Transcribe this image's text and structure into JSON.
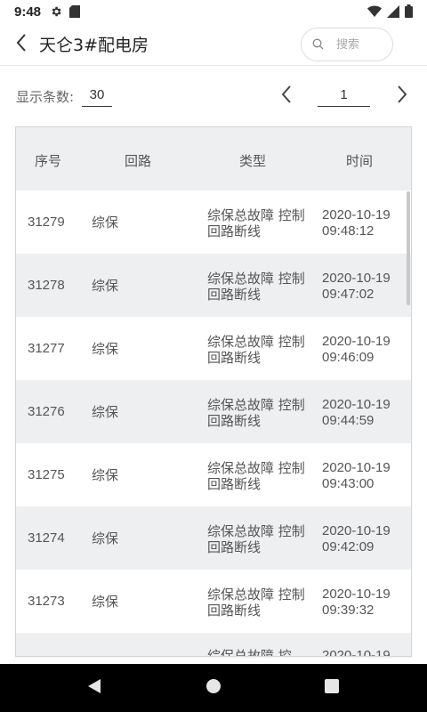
{
  "status_bar": {
    "time": "9:48"
  },
  "header": {
    "title": "天仑3#配电房",
    "search_placeholder": "搜索"
  },
  "toolbar": {
    "count_label": "显示条数:",
    "count_value": "30",
    "page": "1"
  },
  "table": {
    "columns": [
      "序号",
      "回路",
      "类型",
      "时间"
    ],
    "rows": [
      {
        "no": "31279",
        "loop": "综保",
        "type": "综保总故障 控制回路断线",
        "date": "2020-10-19",
        "time": "09:48:12"
      },
      {
        "no": "31278",
        "loop": "综保",
        "type": "综保总故障 控制回路断线",
        "date": "2020-10-19",
        "time": "09:47:02"
      },
      {
        "no": "31277",
        "loop": "综保",
        "type": "综保总故障 控制回路断线",
        "date": "2020-10-19",
        "time": "09:46:09"
      },
      {
        "no": "31276",
        "loop": "综保",
        "type": "综保总故障 控制回路断线",
        "date": "2020-10-19",
        "time": "09:44:59"
      },
      {
        "no": "31275",
        "loop": "综保",
        "type": "综保总故障 控制回路断线",
        "date": "2020-10-19",
        "time": "09:43:00"
      },
      {
        "no": "31274",
        "loop": "综保",
        "type": "综保总故障 控制回路断线",
        "date": "2020-10-19",
        "time": "09:42:09"
      },
      {
        "no": "31273",
        "loop": "综保",
        "type": "综保总故障 控制回路断线",
        "date": "2020-10-19",
        "time": "09:39:32"
      },
      {
        "no": "",
        "loop": "",
        "type": "综保总故障 控",
        "date": "2020-10-19",
        "time": ""
      }
    ]
  },
  "colors": {
    "row_alt": "#eeeff1",
    "nav_bar": "#000000"
  },
  "icons": [
    "gear-icon",
    "sd-card-icon",
    "wifi-icon",
    "signal-icon",
    "battery-icon",
    "back-arrow-icon",
    "search-icon",
    "chevron-left-icon",
    "chevron-right-icon",
    "nav-back-icon",
    "nav-home-icon",
    "nav-recents-icon"
  ]
}
